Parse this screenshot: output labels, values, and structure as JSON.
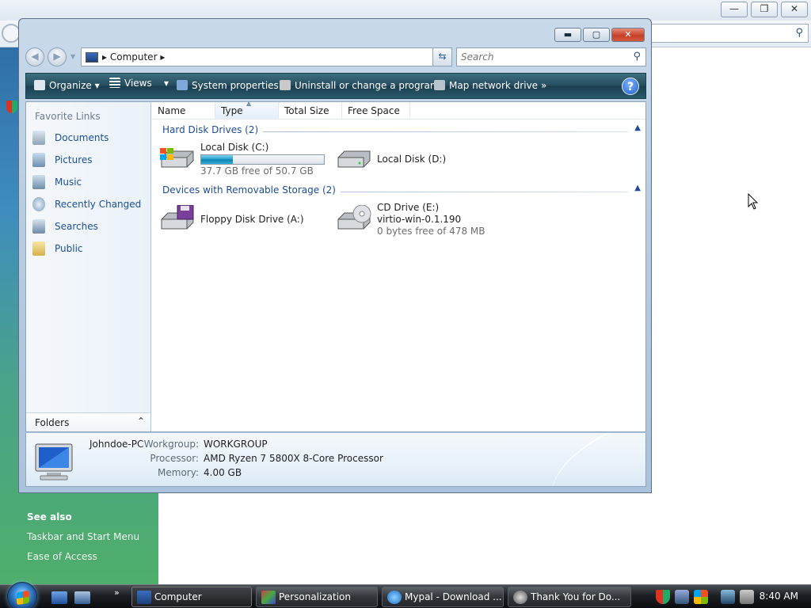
{
  "explorer": {
    "address": {
      "crumb": "Computer"
    },
    "search": {
      "placeholder": "Search"
    },
    "toolbar": {
      "organize": "Organize",
      "views": "Views",
      "system_properties": "System properties",
      "uninstall": "Uninstall or change a program",
      "map_drive": "Map network drive",
      "more": "»",
      "help": "?"
    },
    "nav": {
      "header": "Favorite Links",
      "items": [
        {
          "label": "Documents",
          "icon": "documents-icon"
        },
        {
          "label": "Pictures",
          "icon": "pictures-icon"
        },
        {
          "label": "Music",
          "icon": "music-icon"
        },
        {
          "label": "Recently Changed",
          "icon": "recently-changed-icon"
        },
        {
          "label": "Searches",
          "icon": "searches-icon"
        },
        {
          "label": "Public",
          "icon": "public-folder-icon"
        }
      ],
      "folders": "Folders"
    },
    "columns": [
      "Name",
      "Type",
      "Total Size",
      "Free Space"
    ],
    "groups": {
      "hdd": "Hard Disk Drives (2)",
      "removable": "Devices with Removable Storage (2)"
    },
    "drives": {
      "c": {
        "name": "Local Disk (C:)",
        "free_text": "37.7 GB free of 50.7 GB",
        "used_fraction": 0.26
      },
      "d": {
        "name": "Local Disk (D:)"
      },
      "a": {
        "name": "Floppy Disk Drive (A:)"
      },
      "e": {
        "name": "CD Drive (E:)",
        "label": "virtio-win-0.1.190",
        "free_text": "0 bytes free of 478 MB"
      }
    },
    "details": {
      "pc_name": "Johndoe-PC",
      "workgroup_label": "Workgroup:",
      "workgroup": "WORKGROUP",
      "processor_label": "Processor:",
      "processor": "AMD Ryzen 7 5800X 8-Core Processor",
      "memory_label": "Memory:",
      "memory": "4.00 GB"
    }
  },
  "background_window": {
    "see_also": "See also",
    "links": [
      "Taskbar and Start Menu",
      "Ease of Access"
    ]
  },
  "taskbar": {
    "buttons": [
      {
        "label": "Computer",
        "active": true
      },
      {
        "label": "Personalization"
      },
      {
        "label": "Mypal - Download ..."
      },
      {
        "label": "Thank You for Do..."
      }
    ],
    "ql_more": "»",
    "clock": "8:40 AM"
  }
}
